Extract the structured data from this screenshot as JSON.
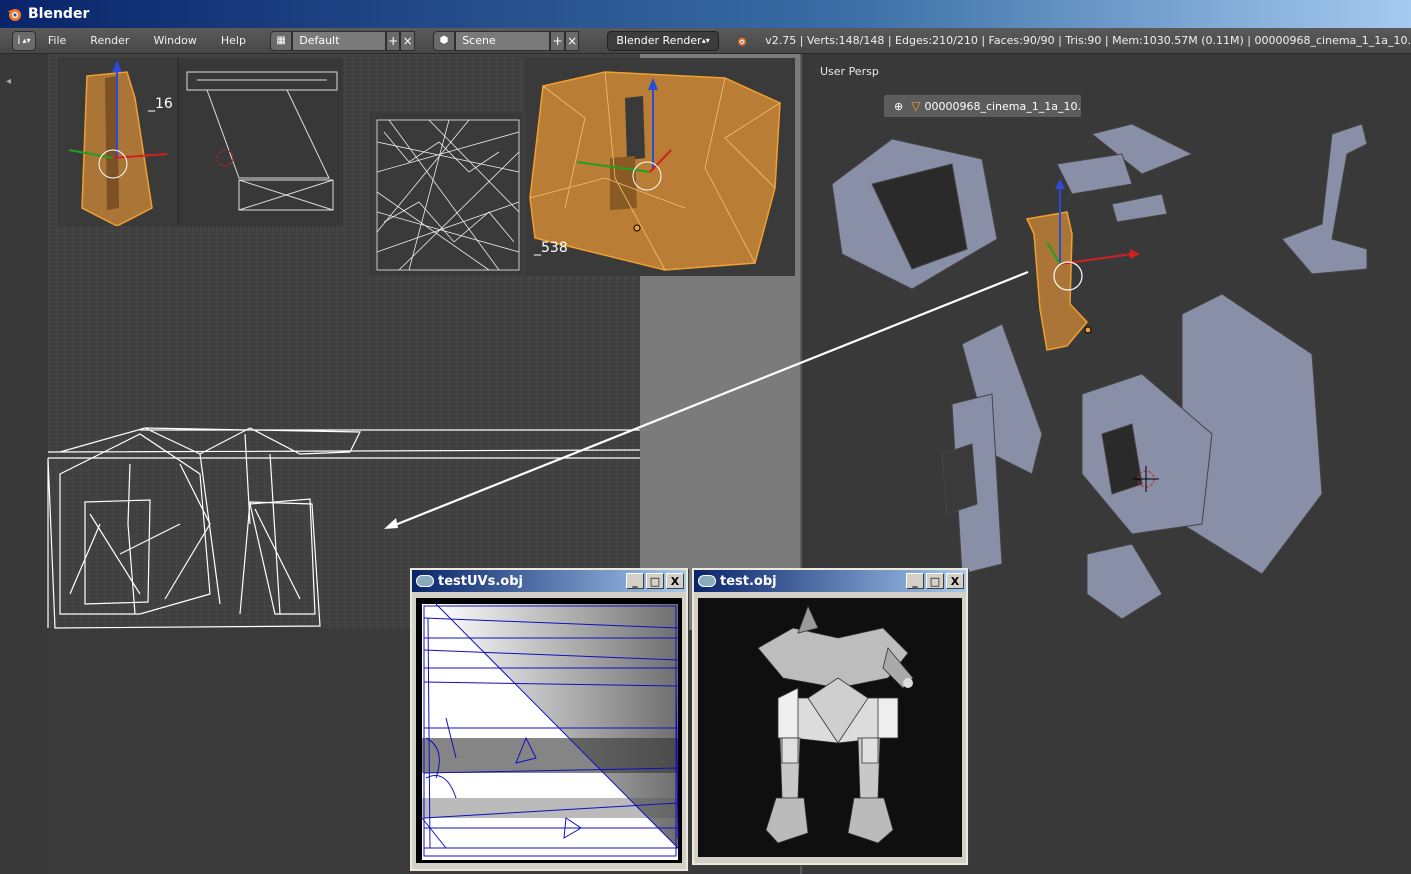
{
  "window": {
    "title": "Blender"
  },
  "infobar": {
    "editor_icon": "i",
    "menu": [
      "File",
      "Render",
      "Window",
      "Help"
    ],
    "screen_layout": "Default",
    "scene": "Scene",
    "render_engine": "Blender Render",
    "stats": "v2.75 | Verts:148/148 | Edges:210/210 | Faces:90/90 | Tris:90 | Mem:1030.57M (0.11M) | 00000968_cinema_1_1a_10."
  },
  "viewport": {
    "view_label": "User Persp",
    "active_object": "00000968_cinema_1_1a_10."
  },
  "thumbnails": {
    "label_a": "_16",
    "label_b": "_538"
  },
  "windows": {
    "uv_window_title": "testUVs.obj",
    "model_window_title": "test.obj",
    "minimize": "_",
    "maximize": "□",
    "close": "X"
  },
  "colors": {
    "accent_orange": "#f0a030",
    "selection_fill": "#d08a35",
    "uv_wire": "#1010c0"
  }
}
